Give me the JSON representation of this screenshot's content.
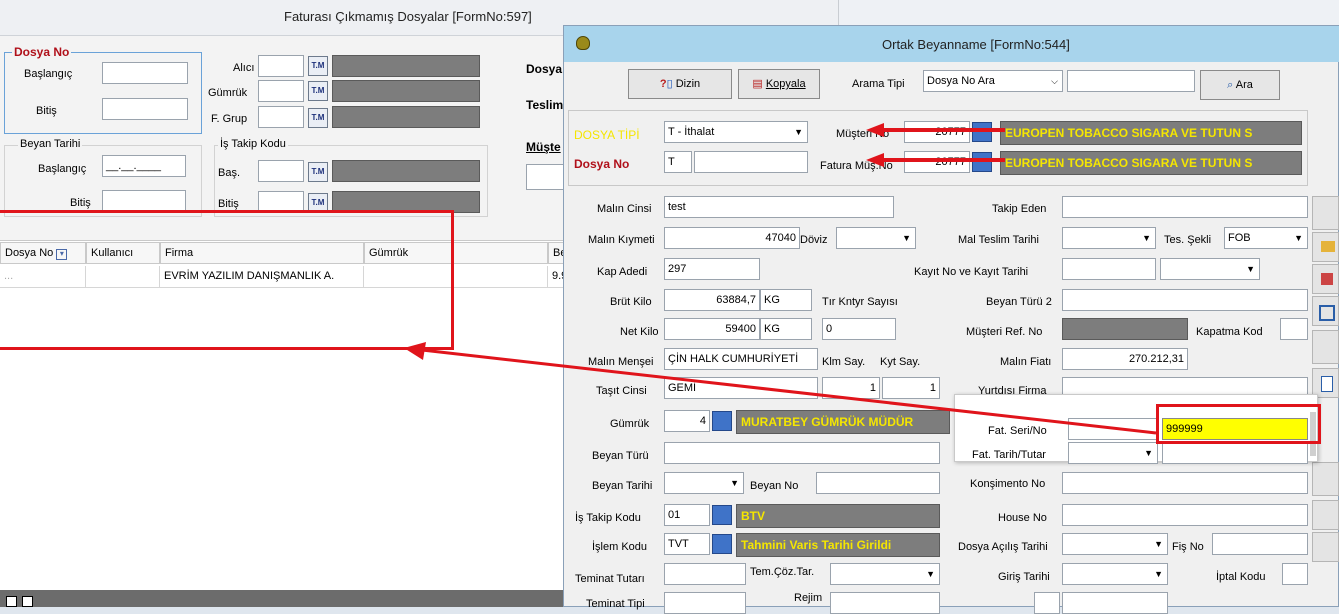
{
  "left_window": {
    "title": "Faturası Çıkmamış Dosyalar [FormNo:597]",
    "dosya_no_group": "Dosya No",
    "baslangic_label": "Başlangıç",
    "bitis_label": "Bitiş",
    "alici_label": "Alıcı",
    "gumruk_label": "Gümrük",
    "fgrup_label": "F. Grup",
    "beyan_tarihi_group": "Beyan Tarihi",
    "beyan_baslangic_label": "Başlangıç",
    "beyan_baslangic_value": "__.__.____",
    "beyan_bitis_label": "Bitiş",
    "is_takip_group": "İş Takip Kodu",
    "bas_label": "Baş.",
    "is_bitis_label": "Bitiş",
    "dosya_label": "Dosya",
    "teslim_label": "Teslim",
    "musteri_label": "Müşte",
    "tm_icon_text": "T.M",
    "columns": [
      "Dosya No",
      "Kullanıcı",
      "Firma",
      "Gümrük",
      "Be"
    ],
    "rows": [
      {
        "dosya_no": "...",
        "kullanici": "",
        "firma": "EVRİM YAZILIM DANIŞMANLIK A.",
        "gumruk": "",
        "be": "9.9"
      }
    ]
  },
  "right_window": {
    "title": "Ortak Beyanname [FormNo:544]",
    "dizin_label": "Dizin",
    "kopyala_label": "Kopyala",
    "arama_tipi_label": "Arama Tipi",
    "arama_tipi_value": "Dosya No Ara",
    "ara_label": "Ara",
    "dosya_tipi_label": "DOSYA TİPİ",
    "dosya_tipi_value": "T - İthalat",
    "dosya_no_label": "Dosya No",
    "dosya_no_value": "T",
    "musteri_no_label": "Müşteri No",
    "musteri_no_value": "20777",
    "musteri_name": "EUROPEN TOBACCO SIGARA VE TUTUN S",
    "fatura_mus_no_label": "Fatura Müş.No",
    "fatura_mus_no_value": "20777",
    "fatura_mus_name": "EUROPEN TOBACCO SIGARA VE TUTUN S",
    "fields": {
      "malin_cinsi_label": "Malın Cinsi",
      "malin_cinsi": "test",
      "malin_kiymeti_label": "Malın Kıymeti",
      "malin_kiymeti": "47040",
      "doviz_label": "Döviz",
      "kap_adedi_label": "Kap Adedi",
      "kap_adedi": "297",
      "brut_kilo_label": "Brüt Kilo",
      "brut_kilo": "63884,7",
      "kg": "KG",
      "tir_label": "Tır Kntyr Sayısı",
      "net_kilo_label": "Net Kilo",
      "net_kilo": "59400",
      "net_kg": "KG",
      "tir_value": "0",
      "mensei_label": "Malın Menşei",
      "mensei": "ÇİN HALK CUMHURİYETİ",
      "klm_label": "Klm Say.",
      "kyt_label": "Kyt Say.",
      "tasit_label": "Taşıt Cinsi",
      "tasit": "GEMİ",
      "klm_value": "1",
      "kyt_value": "1",
      "gumruk_label": "Gümrük",
      "gumruk_code": "4",
      "gumruk_name": "MURATBEY GÜMRÜK MÜDÜR",
      "beyan_turu_label": "Beyan Türü",
      "beyan_tarihi_label": "Beyan Tarihi",
      "beyan_no_label": "Beyan No",
      "is_takip_label": "İş Takip Kodu",
      "is_takip": "01",
      "is_takip_name": "BTV",
      "islem_label": "İşlem Kodu",
      "islem": "TVT",
      "islem_name": "Tahmini Varis Tarihi Girildi",
      "teminat_tutari_label": "Teminat Tutarı",
      "tem_coz_label": "Tem.Çöz.Tar.",
      "teminat_tipi_label": "Teminat Tipi",
      "rejim_label": "Rejim",
      "takip_eden_label": "Takip Eden",
      "mal_teslim_label": "Mal Teslim Tarihi",
      "tes_sekli_label": "Tes. Şekli",
      "tes_sekli": "FOB",
      "kayit_label": "Kayıt No ve Kayıt Tarihi",
      "beyan_turu2_label": "Beyan Türü 2",
      "musteri_ref_label": "Müşteri Ref. No",
      "kapatma_label": "Kapatma Kod",
      "malin_fiati_label": "Malın Fiatı",
      "malin_fiati": "270.212,31",
      "yurtdisi_label": "Yurtdışı Firma",
      "konsimento_label": "Konşimento No",
      "house_label": "House No",
      "dosya_acilis_label": "Dosya Açılış Tarihi",
      "fis_label": "Fiş No",
      "giris_label": "Giriş Tarihi",
      "iptal_label": "İptal Kodu"
    }
  },
  "popup": {
    "fat_seri_label": "Fat. Seri/No",
    "fat_seri_value": "999999",
    "fat_tarih_label": "Fat. Tarih/Tutar"
  },
  "colors": {
    "highlight_red": "#e0141b",
    "yellow": "#ffff00",
    "label_yellow": "#f5e600"
  }
}
